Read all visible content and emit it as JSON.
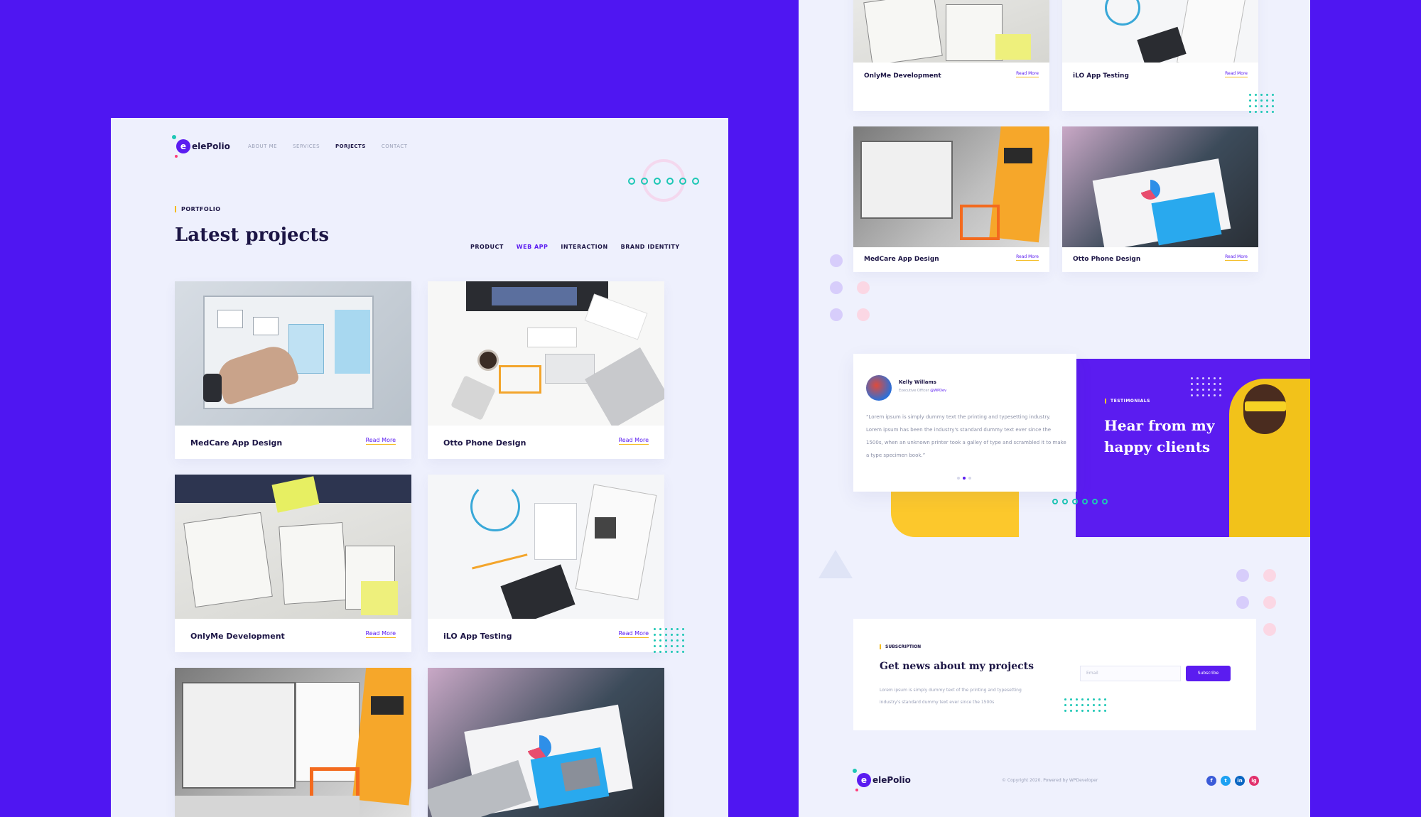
{
  "brand": {
    "name": "elePolio",
    "mark": "e"
  },
  "nav": [
    "ABOUT ME",
    "SERVICES",
    "PORJECTS",
    "CONTACT"
  ],
  "portfolio": {
    "tag": "PORTFOLIO",
    "title": "Latest projects",
    "filters": [
      "PRODUCT",
      "WEB APP",
      "INTERACTION",
      "BRAND IDENTITY"
    ],
    "active_filter": "WEB APP"
  },
  "projects": [
    {
      "title": "MedCare App Design",
      "link": "Read More"
    },
    {
      "title": "Otto Phone Design",
      "link": "Read More"
    },
    {
      "title": "OnlyMe Development",
      "link": "Read More"
    },
    {
      "title": "iLO App Testing",
      "link": "Read More"
    }
  ],
  "right_projects": [
    {
      "title": "OnlyMe Development",
      "link": "Read More"
    },
    {
      "title": "iLO App Testing",
      "link": "Read More"
    },
    {
      "title": "MedCare App Design",
      "link": "Read More"
    },
    {
      "title": "Otto Phone Design",
      "link": "Read More"
    }
  ],
  "testimonial": {
    "name": "Kelly Willams",
    "role": "Executive Officer",
    "handle": "@WPDev",
    "quote": "“Lorem ipsum is simply dummy text the printing and typesetting industry. Lorem ipsum has been the industry's standard dummy text ever since the 1500s, when an unknown printer took a galley of type and scrambled it to make a type specimen book.”",
    "tag": "TESTIMONIALS",
    "title": "Hear from my happy clients"
  },
  "subscription": {
    "tag": "SUBSCRIPTION",
    "title": "Get news about my projects",
    "text": "Lorem ipsum is simply dummy text of the printing and typesetting industry's standard dummy text ever since the 1500s",
    "placeholder": "Email",
    "button": "Subscribe"
  },
  "footer": {
    "copyright": "© Copyright 2020. Powered by WPDeveloper",
    "social": [
      {
        "icon": "facebook-icon",
        "glyph": "f",
        "color": "#3b5bd8"
      },
      {
        "icon": "twitter-icon",
        "glyph": "t",
        "color": "#1da1f2"
      },
      {
        "icon": "linkedin-icon",
        "glyph": "in",
        "color": "#0a66c2"
      },
      {
        "icon": "instagram-icon",
        "glyph": "ig",
        "color": "#e1306c"
      }
    ]
  },
  "colors": {
    "background": "#4f16f2",
    "accent": "#5b1cf0",
    "highlight": "#fcc82c",
    "teal": "#1ec7b5",
    "text_dark": "#1c1545"
  }
}
